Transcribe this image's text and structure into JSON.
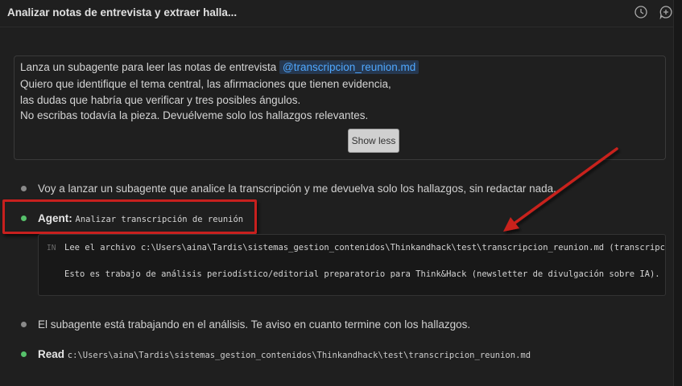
{
  "header": {
    "title": "Analizar notas de entrevista y extraer halla...",
    "history_icon": "history-icon",
    "new_chat_icon": "new-chat-icon"
  },
  "prompt": {
    "line1_prefix": "Lanza un subagente para leer las notas de entrevista",
    "mention": "@transcripcion_reunion.md",
    "line2": "Quiero que identifique el tema central, las afirmaciones que tienen evidencia,",
    "line3": "las dudas que habría que verificar y tres posibles ángulos.",
    "line4": "No escribas todavía la pieza. Devuélveme solo los hallazgos relevantes.",
    "show_less_label": "Show less"
  },
  "messages": {
    "m1": "Voy a lanzar un subagente que analice la transcripción y me devuelva solo los hallazgos, sin redactar nada.",
    "agent_label": "Agent:",
    "agent_task": "Analizar transcripción de reunión",
    "code_in_label": "IN",
    "code_line1": "Lee el archivo c:\\Users\\aina\\Tardis\\sistemas_gestion_contenidos\\Thinkandhack\\test\\transcripcion_reunion.md (transcripción",
    "code_line2": "Esto es trabajo de análisis periodístico/editorial preparatorio para Think&Hack (newsletter de divulgación sobre IA). NO e",
    "m2": "El subagente está trabajando en el análisis. Te aviso en cuanto termine con los hallazgos.",
    "read_label": "Read",
    "read_path": "c:\\Users\\aina\\Tardis\\sistemas_gestion_contenidos\\Thinkandhack\\test\\transcripcion_reunion.md"
  },
  "colors": {
    "background": "#1f1f1f",
    "mention_text": "#4fa8ff",
    "green_bullet": "#56c16b",
    "annotation_red": "#c8201e"
  }
}
